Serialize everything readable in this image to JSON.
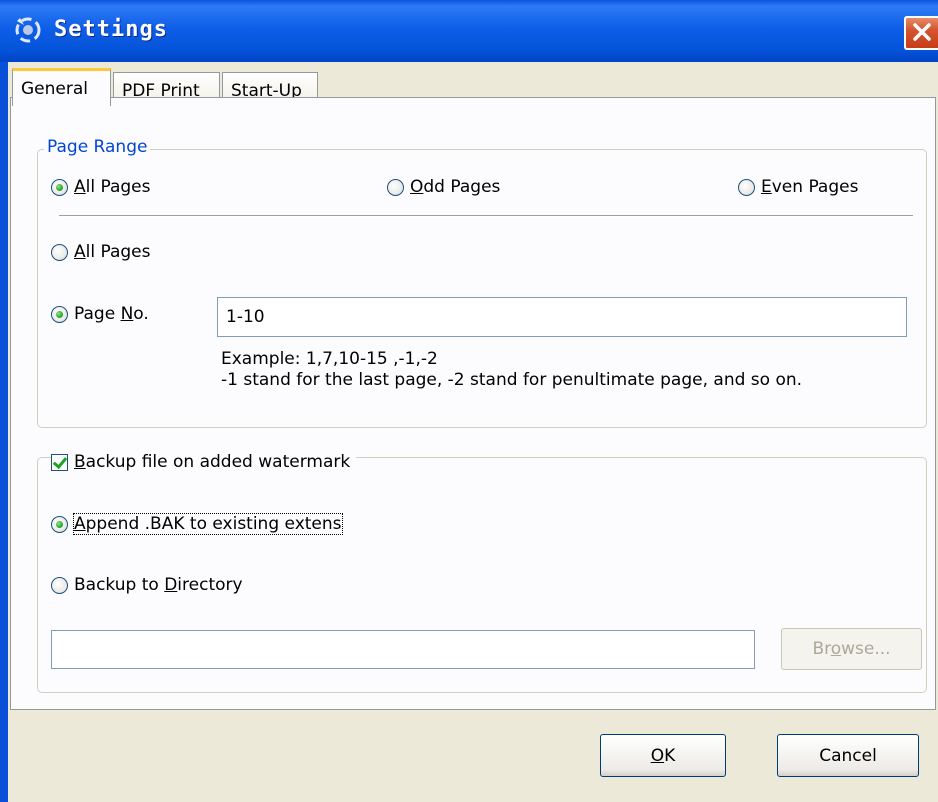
{
  "window": {
    "title": "Settings"
  },
  "tabs": [
    {
      "label": "General",
      "active": true
    },
    {
      "label": "PDF Print",
      "active": false
    },
    {
      "label": "Start-Up",
      "active": false
    }
  ],
  "page_range": {
    "legend": "Page Range",
    "all_pages_1": {
      "label_pre": "",
      "mnemonic": "A",
      "label_post": "ll Pages",
      "checked": true
    },
    "odd_pages": {
      "label_pre": "",
      "mnemonic": "O",
      "label_post": "dd Pages",
      "checked": false
    },
    "even_pages": {
      "label_pre": "",
      "mnemonic": "E",
      "label_post": "ven Pages",
      "checked": false
    },
    "all_pages_2": {
      "label_pre": "",
      "mnemonic": "A",
      "label_post": "ll Pages",
      "checked": false
    },
    "page_no": {
      "label_pre": "Page ",
      "mnemonic": "N",
      "label_post": "o.",
      "checked": true
    },
    "page_no_value": "1-10",
    "example_line1": "Example: 1,7,10-15 ,-1,-2",
    "example_line2": "-1 stand for the last page, -2 stand for penultimate page, and so on."
  },
  "backup": {
    "checkbox": {
      "label_pre": "",
      "mnemonic": "B",
      "label_post": "ackup file on added watermark",
      "checked": true
    },
    "append_bak": {
      "label_pre": "",
      "mnemonic": "A",
      "label_post": "ppend .BAK to existing extens",
      "checked": true
    },
    "backup_dir": {
      "label_pre": "Backup to ",
      "mnemonic": "D",
      "label_post": "irectory",
      "checked": false
    },
    "directory_value": "",
    "browse": {
      "label_pre": "Br",
      "mnemonic": "o",
      "label_post": "wse...",
      "enabled": false
    }
  },
  "buttons": {
    "ok": {
      "label_pre": "",
      "mnemonic": "O",
      "label_post": "K"
    },
    "cancel": {
      "label_pre": "Cancel",
      "mnemonic": "",
      "label_post": ""
    }
  },
  "colors": {
    "titlebar": "#0554d9",
    "group_legend": "#0046d5",
    "tab_highlight": "#ffc83c",
    "radio_check": "#21a121",
    "close_button": "#d35530"
  },
  "icons": {
    "title": "app-swirl-icon",
    "close": "close-icon"
  }
}
